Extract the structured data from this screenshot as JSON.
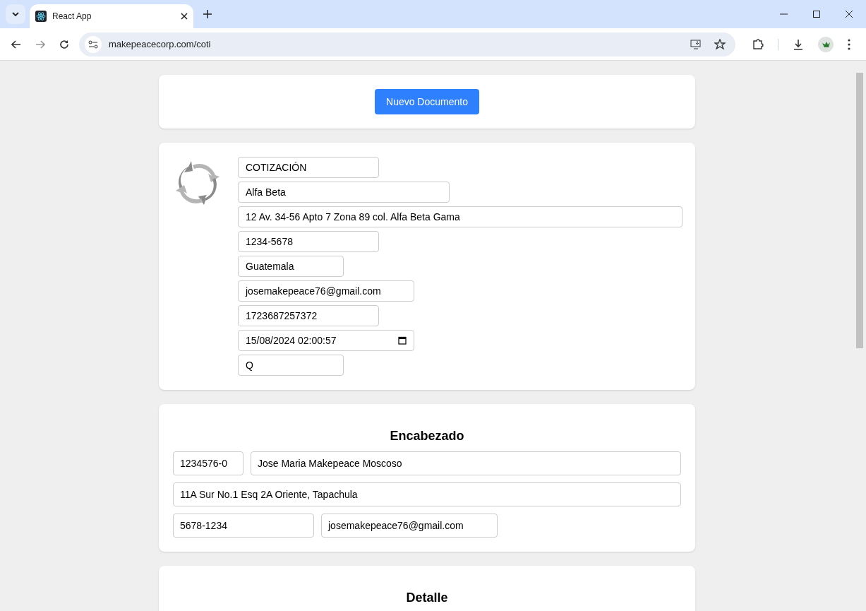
{
  "browser": {
    "tab_title": "React App",
    "url": "makepeacecorp.com/coti"
  },
  "toolbar": {
    "button": "Nuevo Documento"
  },
  "company": {
    "fields": [
      {
        "kind": "text",
        "value": "COTIZACIÓN"
      },
      {
        "kind": "text",
        "value": "Alfa Beta"
      },
      {
        "kind": "text",
        "value": "12 Av. 34-56 Apto 7 Zona 89 col. Alfa Beta Gama"
      },
      {
        "kind": "text",
        "value": "1234-5678"
      },
      {
        "kind": "text",
        "value": "Guatemala"
      },
      {
        "kind": "text",
        "value": "josemakepeace76@gmail.com"
      },
      {
        "kind": "text",
        "value": "1723687257372"
      },
      {
        "kind": "datetime",
        "value": "15/08/2024 02:00:57"
      },
      {
        "kind": "text",
        "value": "Q"
      }
    ]
  },
  "header": {
    "title": "Encabezado",
    "rows": [
      [
        "1234576-0",
        "Jose Maria Makepeace Moscoso"
      ],
      [
        "11A Sur No.1 Esq 2A Oriente, Tapachula"
      ],
      [
        "5678-1234",
        "josemakepeace76@gmail.com"
      ]
    ]
  },
  "detail": {
    "title": "Detalle"
  }
}
